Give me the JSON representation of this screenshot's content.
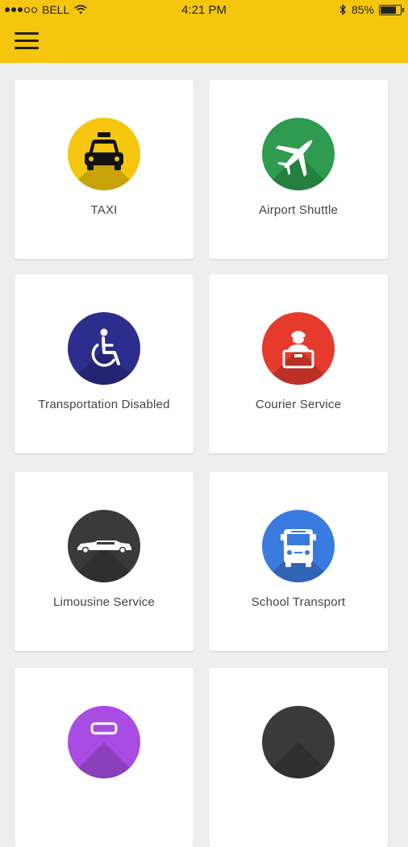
{
  "status_bar": {
    "carrier": "BELL",
    "time": "4:21 PM",
    "battery": "85%",
    "battery_level": 0.85
  },
  "colors": {
    "header": "#f5c60d",
    "taxi": "#f5c60d",
    "airport": "#2e9b4e",
    "disabled": "#2c2d8c",
    "courier": "#e53a2c",
    "limo": "#3a3a3a",
    "school": "#3a7be0",
    "purple": "#a94ce3",
    "dark": "#3a3a3a"
  },
  "services": [
    {
      "label": "TAXI",
      "icon": "taxi-icon"
    },
    {
      "label": "Airport Shuttle",
      "icon": "airplane-icon"
    },
    {
      "label": "Transportation Disabled",
      "icon": "wheelchair-icon"
    },
    {
      "label": "Courier Service",
      "icon": "courier-icon"
    },
    {
      "label": "Limousine Service",
      "icon": "limousine-icon"
    },
    {
      "label": "School Transport",
      "icon": "school-bus-icon"
    }
  ]
}
